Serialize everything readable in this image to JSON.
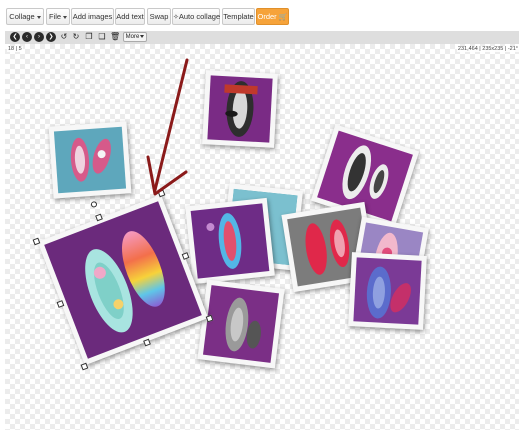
{
  "menubar": {
    "collage": "Collage",
    "file": "File",
    "add_images": "Add images",
    "add_text": "Add text",
    "swap": "Swap",
    "auto_collage": "Auto collage",
    "template": "Template",
    "order": "Order"
  },
  "toolbar": {
    "more": "More"
  },
  "canvas": {
    "coord_left": "18 | 5",
    "coord_right": "231,464 | 235x235 | -21°"
  },
  "colors": {
    "accent": "#f6a33a",
    "arrow": "#8b1a1a",
    "selection_handle": "#333333"
  },
  "icons": [
    "collage-caret-icon",
    "file-caret-icon",
    "wand-icon",
    "cart-icon",
    "first-icon",
    "prev-icon",
    "next-icon",
    "last-icon",
    "undo-icon",
    "redo-icon",
    "copy-icon",
    "paste-icon",
    "trash-icon",
    "more-caret-icon"
  ]
}
